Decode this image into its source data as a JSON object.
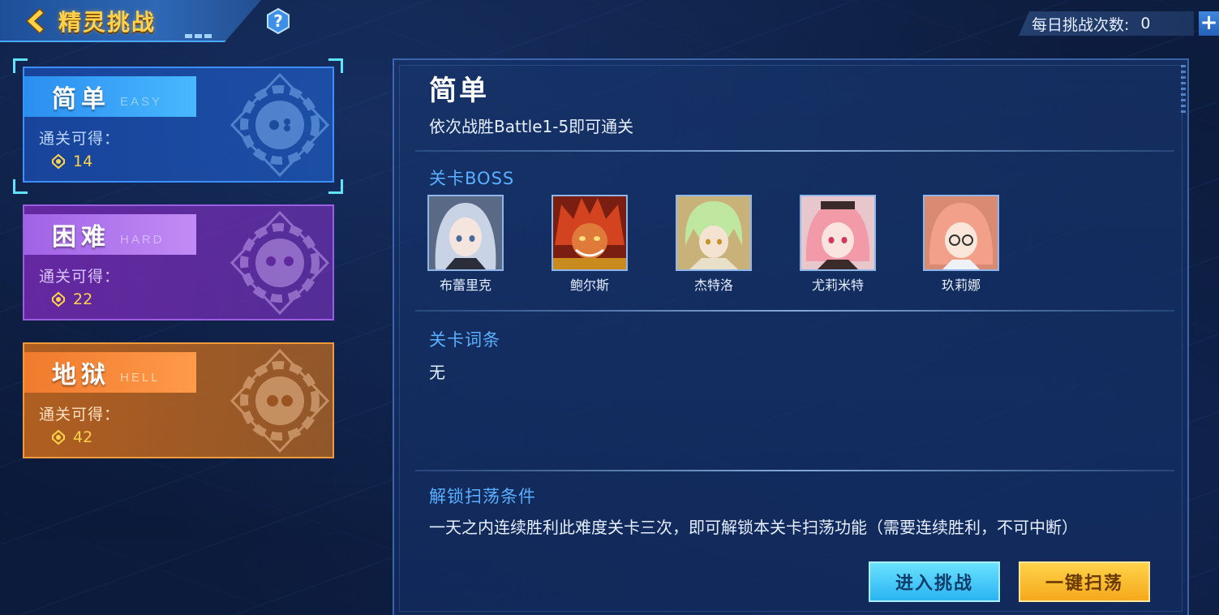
{
  "header": {
    "title": "精灵挑战",
    "back_icon": "chevron-left-icon",
    "help_icon": "question-icon",
    "help_text": "?"
  },
  "daily": {
    "label": "每日挑战次数:",
    "count": "0",
    "plus": "+"
  },
  "difficulties": [
    {
      "name": "简单",
      "en": "EASY",
      "reward_label": "通关可得：",
      "reward_value": "14",
      "selected": true,
      "color": "#2a8ef0"
    },
    {
      "name": "困难",
      "en": "HARD",
      "reward_label": "通关可得：",
      "reward_value": "22",
      "selected": false,
      "color": "#a062e6"
    },
    {
      "name": "地狱",
      "en": "HELL",
      "reward_label": "通关可得：",
      "reward_value": "42",
      "selected": false,
      "color": "#f07a2c"
    }
  ],
  "detail": {
    "title": "简单",
    "description": "依次战胜Battle1-5即可通关",
    "boss_heading": "关卡BOSS",
    "bosses": [
      {
        "name": "布蕾里克",
        "hair": "#c9d3e6"
      },
      {
        "name": "鲍尔斯",
        "hair": "#d4431f"
      },
      {
        "name": "杰特洛",
        "hair": "#bfe7a0"
      },
      {
        "name": "尤莉米特",
        "hair": "#f29aa8"
      },
      {
        "name": "玖莉娜",
        "hair": "#f2a08a"
      }
    ],
    "affix_heading": "关卡词条",
    "affix_value": "无",
    "unlock_heading": "解锁扫荡条件",
    "unlock_text": "一天之内连续胜利此难度关卡三次，即可解锁本关卡扫荡功能（需要连续胜利，不可中断）"
  },
  "buttons": {
    "enter": "进入挑战",
    "sweep": "一键扫荡"
  }
}
